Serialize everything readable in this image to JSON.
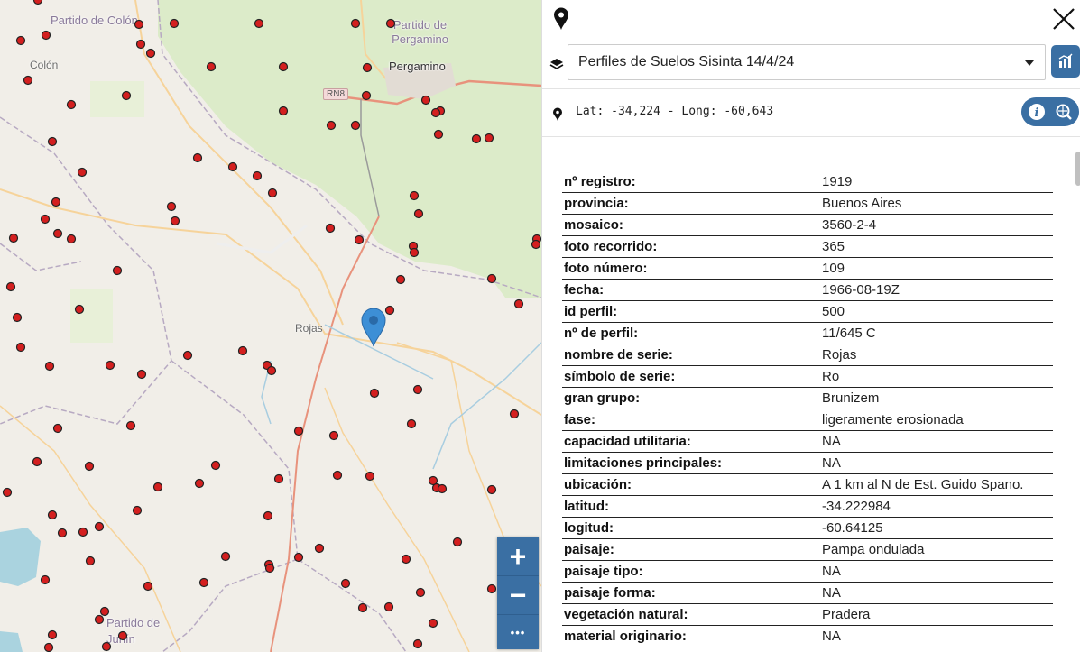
{
  "map": {
    "labels": {
      "partido_colon": "Partido de Colón",
      "colon": "Colón",
      "partido_pergamino": "Partido de Pergamino",
      "pergamino": "Pergamino",
      "rn8": "RN8",
      "rojas": "Rojas",
      "partido_junin": "Partido de Junín"
    },
    "zoom": {
      "in": "+",
      "out": "−",
      "more": "•••"
    }
  },
  "panel": {
    "layer_select": {
      "selected": "Perfiles de Suelos Sisinta 14/4/24"
    },
    "coords": "Lat: -34,224 - Long: -60,643",
    "attributes": [
      {
        "k": "nº registro:",
        "v": "1919"
      },
      {
        "k": "provincia:",
        "v": "Buenos Aires"
      },
      {
        "k": "mosaico:",
        "v": "3560-2-4"
      },
      {
        "k": "foto recorrido:",
        "v": "365"
      },
      {
        "k": "foto número:",
        "v": "109"
      },
      {
        "k": "fecha:",
        "v": "1966-08-19Z"
      },
      {
        "k": "id perfil:",
        "v": "500"
      },
      {
        "k": "nº de perfil:",
        "v": "11/645 C"
      },
      {
        "k": "nombre de serie:",
        "v": "Rojas"
      },
      {
        "k": "símbolo de serie:",
        "v": "Ro"
      },
      {
        "k": "gran grupo:",
        "v": "Brunizem"
      },
      {
        "k": "fase:",
        "v": "ligeramente erosionada"
      },
      {
        "k": "capacidad utilitaria:",
        "v": "NA"
      },
      {
        "k": "limitaciones principales:",
        "v": "NA"
      },
      {
        "k": "ubicación:",
        "v": "A 1 km al N de Est. Guido Spano."
      },
      {
        "k": "latitud:",
        "v": "-34.222984"
      },
      {
        "k": "logitud:",
        "v": "-60.64125"
      },
      {
        "k": "paisaje:",
        "v": "Pampa ondulada"
      },
      {
        "k": "paisaje tipo:",
        "v": "NA"
      },
      {
        "k": "paisaje forma:",
        "v": "NA"
      },
      {
        "k": "vegetación natural:",
        "v": "Pradera"
      },
      {
        "k": "material originario:",
        "v": "NA"
      }
    ]
  },
  "colors": {
    "accent": "#3a6fa3",
    "marker": "#d41f1f",
    "pin": "#3d8fd6"
  }
}
